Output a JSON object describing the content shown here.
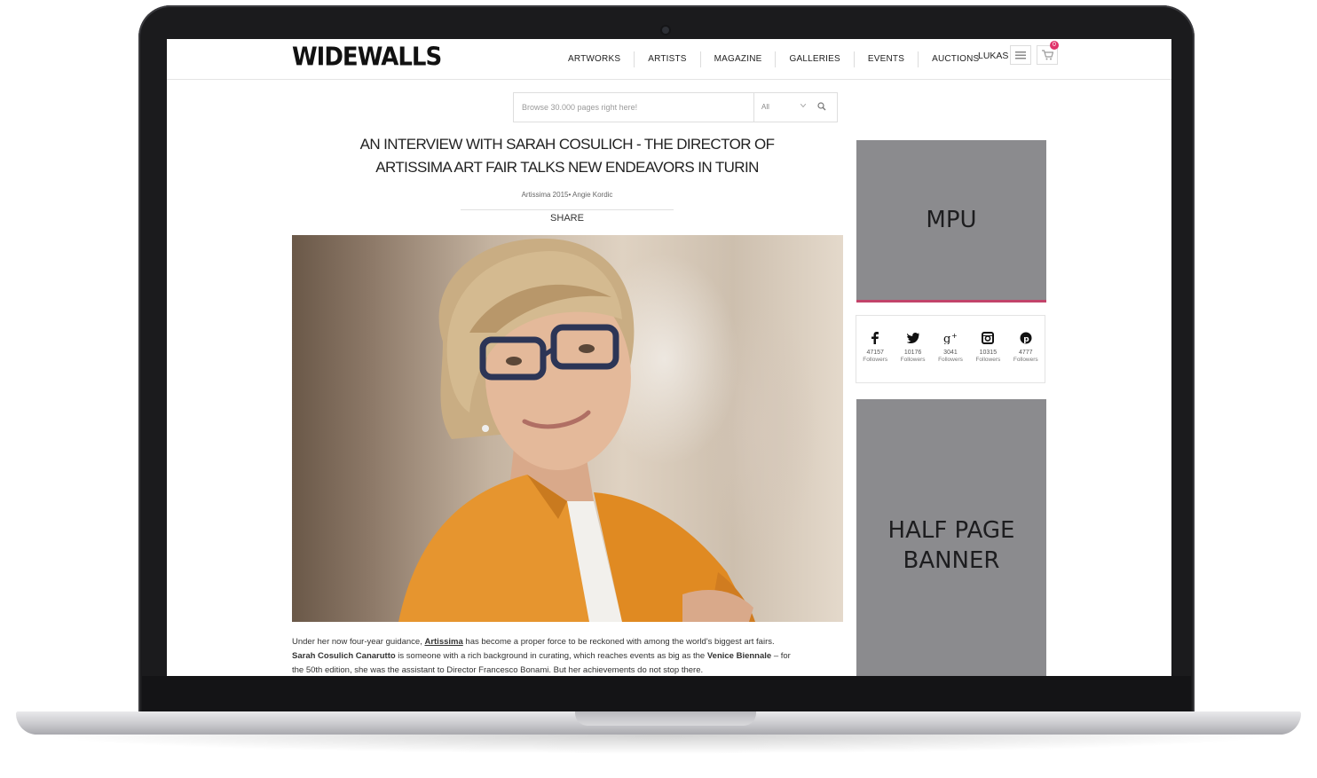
{
  "site": {
    "logo": "WIDEWALLS",
    "nav": [
      "ARTWORKS",
      "ARTISTS",
      "MAGAZINE",
      "GALLERIES",
      "EVENTS",
      "AUCTIONS"
    ],
    "user": "LUKAS",
    "cart_count": "0"
  },
  "search": {
    "placeholder": "Browse 30.000 pages right here!",
    "category": "All"
  },
  "article": {
    "title_line1": "AN INTERVIEW WITH SARAH COSULICH - THE DIRECTOR OF",
    "title_line2": "ARTISSIMA ART FAIR TALKS NEW ENDEAVORS IN TURIN",
    "byline": "Artissima 2015• Angie Kordic",
    "share": "SHARE",
    "body": {
      "p1_before": "Under her now four-year guidance, ",
      "p1_link": "Artissima",
      "p1_after": " has become a proper force to be reckoned with among the world's biggest art fairs.",
      "p2_name": "Sarah Cosulich Canarutto",
      "p2_mid": " is someone with a rich background in curating, which reaches events as big as the ",
      "p2_event": "Venice Biennale",
      "p2_after": " – for",
      "p3": "the 50th edition, she was the assistant to Director Francesco Bonami. But her achievements do not stop there."
    }
  },
  "sidebar": {
    "mpu_label": "MPU",
    "half_page_line1": "HALF PAGE",
    "half_page_line2": "BANNER",
    "social": [
      {
        "icon": "facebook-icon",
        "count": "47157",
        "label": "Followers"
      },
      {
        "icon": "twitter-icon",
        "count": "10176",
        "label": "Followers"
      },
      {
        "icon": "google-plus-icon",
        "count": "3041",
        "label": "Followers"
      },
      {
        "icon": "instagram-icon",
        "count": "10315",
        "label": "Followers"
      },
      {
        "icon": "pinterest-icon",
        "count": "4777",
        "label": "Followers"
      }
    ]
  },
  "colors": {
    "ad_gray": "#8b8b8e",
    "accent_pink": "#c2446a",
    "jacket_orange": "#e6952f"
  }
}
